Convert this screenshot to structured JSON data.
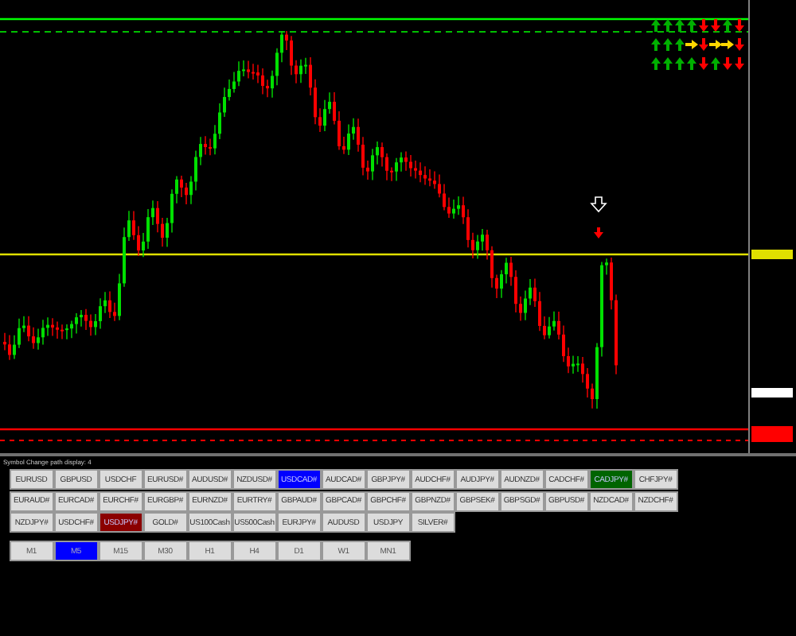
{
  "signal_matrix": {
    "rows": [
      {
        "arrows": [
          {
            "kind": "up"
          },
          {
            "kind": "up"
          },
          {
            "kind": "up"
          },
          {
            "kind": "up"
          },
          {
            "kind": "down"
          },
          {
            "kind": "down"
          },
          {
            "kind": "up"
          },
          {
            "kind": "down"
          }
        ]
      },
      {
        "arrows": [
          {
            "kind": "up"
          },
          {
            "kind": "up"
          },
          {
            "kind": "up"
          },
          {
            "kind": "flat"
          },
          {
            "kind": "down"
          },
          {
            "kind": "flat"
          },
          {
            "kind": "flat"
          },
          {
            "kind": "down"
          }
        ]
      },
      {
        "arrows": [
          {
            "kind": "up"
          },
          {
            "kind": "up"
          },
          {
            "kind": "up"
          },
          {
            "kind": "up"
          },
          {
            "kind": "down"
          },
          {
            "kind": "up"
          },
          {
            "kind": "down"
          },
          {
            "kind": "down"
          }
        ]
      }
    ]
  },
  "symbol_panel": {
    "label": "Symbol Change path display: 4",
    "symbols": [
      {
        "label": "EURUSD",
        "color": "#dcdcdc"
      },
      {
        "label": "GBPUSD",
        "color": "#dcdcdc"
      },
      {
        "label": "USDCHF",
        "color": "#dcdcdc"
      },
      {
        "label": "EURUSD#",
        "color": "#dcdcdc"
      },
      {
        "label": "AUDUSD#",
        "color": "#dcdcdc"
      },
      {
        "label": "NZDUSD#",
        "color": "#dcdcdc"
      },
      {
        "label": "USDCAD#",
        "color": "#0000ff"
      },
      {
        "label": "AUDCAD#",
        "color": "#dcdcdc"
      },
      {
        "label": "GBPJPY#",
        "color": "#dcdcdc"
      },
      {
        "label": "AUDCHF#",
        "color": "#dcdcdc"
      },
      {
        "label": "AUDJPY#",
        "color": "#dcdcdc"
      },
      {
        "label": "AUDNZD#",
        "color": "#dcdcdc"
      },
      {
        "label": "CADCHF#",
        "color": "#dcdcdc"
      },
      {
        "label": "CADJPY#",
        "color": "#006400"
      },
      {
        "label": "CHFJPY#",
        "color": "#dcdcdc"
      },
      {
        "label": "EURAUD#",
        "color": "#dcdcdc"
      },
      {
        "label": "EURCAD#",
        "color": "#dcdcdc"
      },
      {
        "label": "EURCHF#",
        "color": "#dcdcdc"
      },
      {
        "label": "EURGBP#",
        "color": "#dcdcdc"
      },
      {
        "label": "EURNZD#",
        "color": "#dcdcdc"
      },
      {
        "label": "EURTRY#",
        "color": "#dcdcdc"
      },
      {
        "label": "GBPAUD#",
        "color": "#dcdcdc"
      },
      {
        "label": "GBPCAD#",
        "color": "#dcdcdc"
      },
      {
        "label": "GBPCHF#",
        "color": "#dcdcdc"
      },
      {
        "label": "GBPNZD#",
        "color": "#dcdcdc"
      },
      {
        "label": "GBPSEK#",
        "color": "#dcdcdc"
      },
      {
        "label": "GBPSGD#",
        "color": "#dcdcdc"
      },
      {
        "label": "GBPUSD#",
        "color": "#dcdcdc"
      },
      {
        "label": "NZDCAD#",
        "color": "#dcdcdc"
      },
      {
        "label": "NZDCHF#",
        "color": "#dcdcdc"
      },
      {
        "label": "NZDJPY#",
        "color": "#dcdcdc"
      },
      {
        "label": "USDCHF#",
        "color": "#dcdcdc"
      },
      {
        "label": "USDJPY#",
        "color": "#8b0000"
      },
      {
        "label": "GOLD#",
        "color": "#dcdcdc"
      },
      {
        "label": "US100Cash",
        "color": "#dcdcdc"
      },
      {
        "label": "US500Cash",
        "color": "#dcdcdc"
      },
      {
        "label": "EURJPY#",
        "color": "#dcdcdc"
      },
      {
        "label": "AUDUSD",
        "color": "#dcdcdc"
      },
      {
        "label": "USDJPY",
        "color": "#dcdcdc"
      },
      {
        "label": "SILVER#",
        "color": "#dcdcdc"
      }
    ],
    "timeframes": [
      {
        "label": "M1",
        "selected": false
      },
      {
        "label": "M5",
        "selected": true
      },
      {
        "label": "M15",
        "selected": false
      },
      {
        "label": "M30",
        "selected": false
      },
      {
        "label": "H1",
        "selected": false
      },
      {
        "label": "H4",
        "selected": false
      },
      {
        "label": "D1",
        "selected": false
      },
      {
        "label": "W1",
        "selected": false
      },
      {
        "label": "MN1",
        "selected": false
      }
    ]
  }
}
